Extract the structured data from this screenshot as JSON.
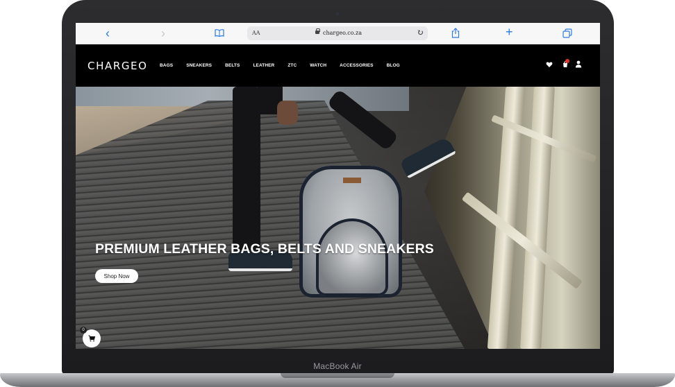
{
  "device": {
    "model_label": "MacBook Air"
  },
  "browser": {
    "text_size_label": "AA",
    "url": "chargeo.co.za"
  },
  "site": {
    "logo": "CHARGEO",
    "menu": [
      {
        "label": "BAGS"
      },
      {
        "label": "SNEAKERS"
      },
      {
        "label": "BELTS"
      },
      {
        "label": "LEATHER"
      },
      {
        "label": "ZTC"
      },
      {
        "label": "WATCH"
      },
      {
        "label": "ACCESSORIES"
      },
      {
        "label": "BLOG"
      }
    ],
    "icons": [
      "heart-icon",
      "cart-icon",
      "user-icon"
    ]
  },
  "hero": {
    "title": "PREMIUM LEATHER BAGS, BELTS AND SNEAKERS",
    "button_label": "Shop Now"
  },
  "floating_cart": {
    "count": "0"
  },
  "colors": {
    "browser_accent": "#2a7ae2",
    "header_bg": "#000000",
    "cart_badge": "#e0342f"
  }
}
